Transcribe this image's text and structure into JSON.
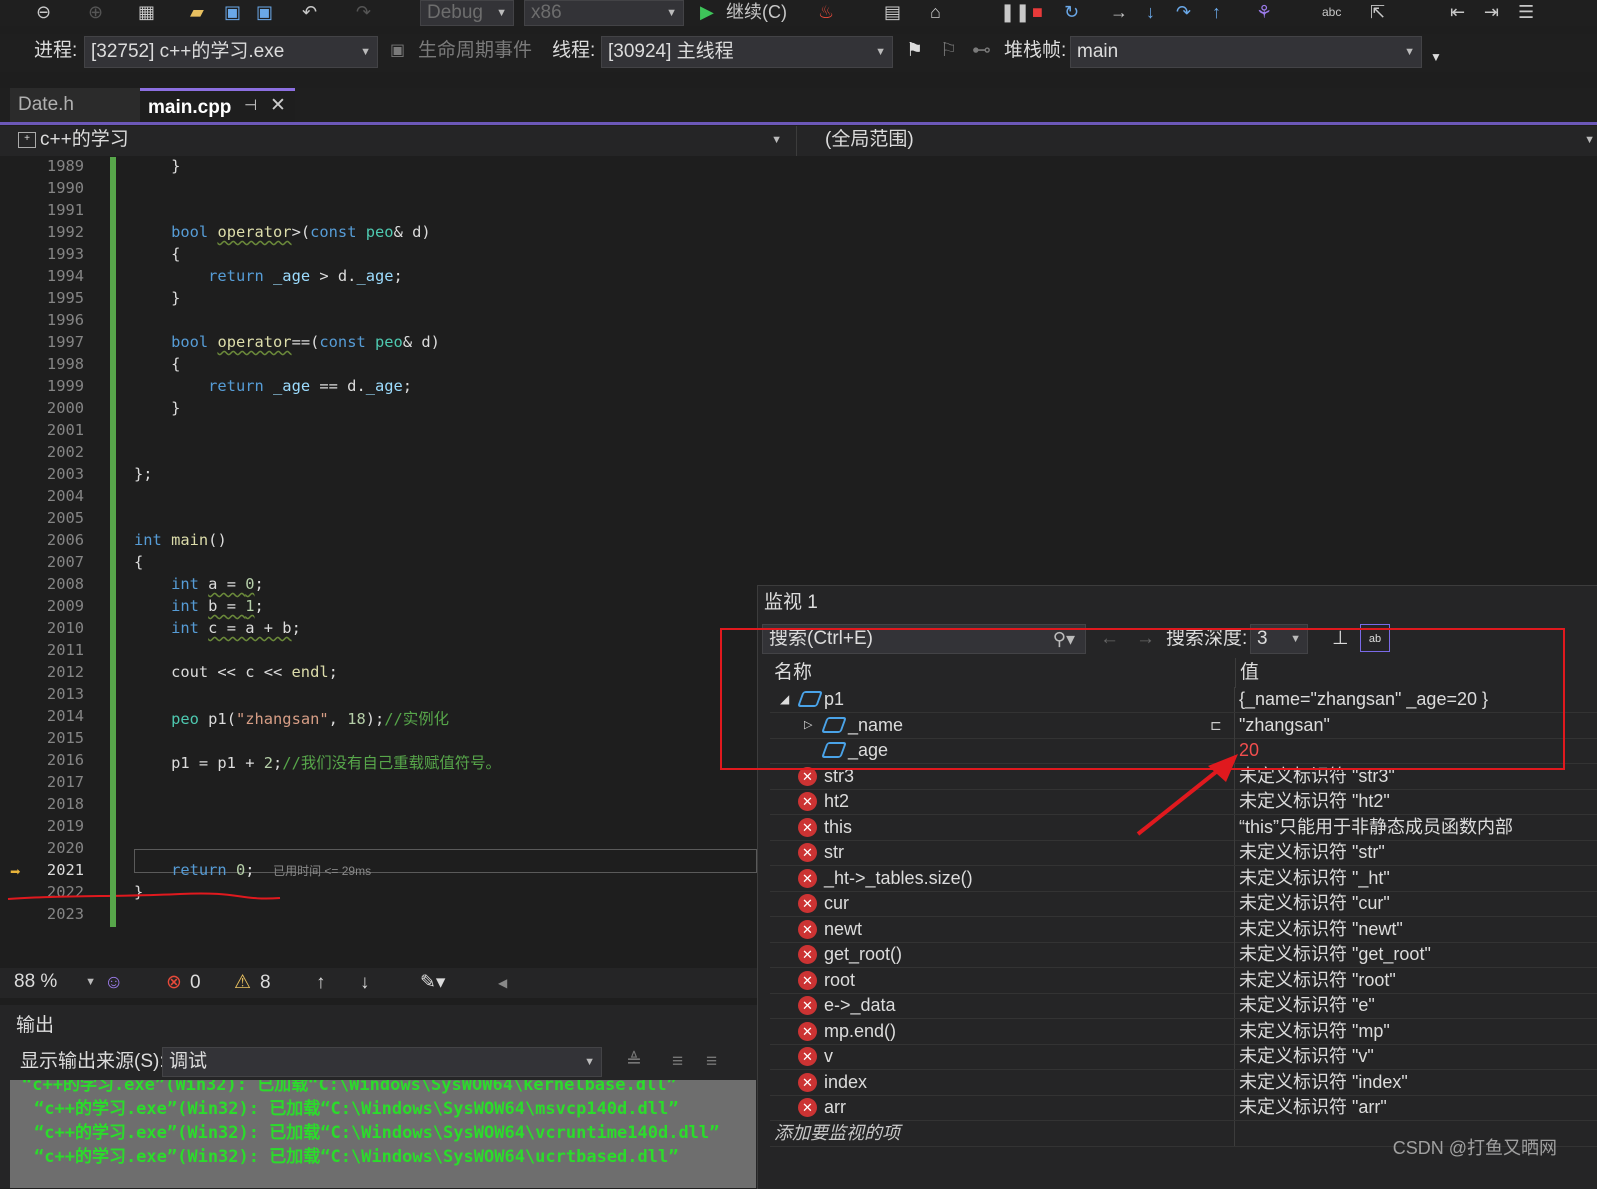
{
  "toolbar": {
    "config": "Debug",
    "platform": "x86",
    "continue_label": "继续(C)"
  },
  "debug_bar": {
    "process_label": "进程:",
    "process_value": "[32752] c++的学习.exe",
    "lifecycle_label": "生命周期事件",
    "thread_label": "线程:",
    "thread_value": "[30924] 主线程",
    "stackframe_label": "堆栈帧:",
    "stackframe_value": "main"
  },
  "tabs": [
    {
      "label": "Date.h"
    },
    {
      "label": "main.cpp"
    }
  ],
  "nav": {
    "project": "c++的学习",
    "scope": "(全局范围)"
  },
  "editor": {
    "line_numbers": [
      "1989",
      "1990",
      "1991",
      "1992",
      "1993",
      "1994",
      "1995",
      "1996",
      "1997",
      "1998",
      "1999",
      "2000",
      "2001",
      "2002",
      "2003",
      "2004",
      "2005",
      "2006",
      "2007",
      "2008",
      "2009",
      "2010",
      "2011",
      "2012",
      "2013",
      "2014",
      "2015",
      "2016",
      "2017",
      "2018",
      "2019",
      "2020",
      "2021",
      "2022",
      "2023"
    ],
    "elapsed_hint": "已用时间 <= 29ms",
    "comment_instantiate": "//实例化",
    "comment_assign": "//我们没有自己重载赋值符号。",
    "string_literal": "\"zhangsan\""
  },
  "status": {
    "zoom": "88 %",
    "errors": "0",
    "warnings": "8"
  },
  "output": {
    "title": "输出",
    "source_label": "显示输出来源(S):",
    "source_value": "调试",
    "lines": [
      "“c++的学习.exe”(Win32): 已加载“C:\\Windows\\SysWOW64\\kernelbase.dll”",
      "“c++的学习.exe”(Win32): 已加载“C:\\Windows\\SysWOW64\\msvcp140d.dll”",
      "“c++的学习.exe”(Win32): 已加载“C:\\Windows\\SysWOW64\\vcruntime140d.dll”",
      "“c++的学习.exe”(Win32): 已加载“C:\\Windows\\SysWOW64\\ucrtbased.dll”"
    ]
  },
  "watch": {
    "title": "监视 1",
    "search_placeholder": "搜索(Ctrl+E)",
    "depth_label": "搜索深度:",
    "depth_value": "3",
    "col_name": "名称",
    "col_value": "值",
    "rows": [
      {
        "name": "p1",
        "value": "{_name=\"zhangsan\" _age=20 }",
        "kind": "object",
        "level": 0
      },
      {
        "name": "_name",
        "value": "\"zhangsan\"",
        "kind": "object",
        "level": 1
      },
      {
        "name": "_age",
        "value": "20",
        "kind": "object",
        "level": 1
      },
      {
        "name": "str3",
        "value": "未定义标识符 \"str3\"",
        "kind": "error",
        "level": 0
      },
      {
        "name": "ht2",
        "value": "未定义标识符 \"ht2\"",
        "kind": "error",
        "level": 0
      },
      {
        "name": "this",
        "value": "“this”只能用于非静态成员函数内部",
        "kind": "error",
        "level": 0
      },
      {
        "name": "str",
        "value": "未定义标识符 \"str\"",
        "kind": "error",
        "level": 0
      },
      {
        "name": "_ht->_tables.size()",
        "value": "未定义标识符 \"_ht\"",
        "kind": "error",
        "level": 0
      },
      {
        "name": "cur",
        "value": "未定义标识符 \"cur\"",
        "kind": "error",
        "level": 0
      },
      {
        "name": "newt",
        "value": "未定义标识符 \"newt\"",
        "kind": "error",
        "level": 0
      },
      {
        "name": "get_root()",
        "value": "未定义标识符 \"get_root\"",
        "kind": "error",
        "level": 0
      },
      {
        "name": "root",
        "value": "未定义标识符 \"root\"",
        "kind": "error",
        "level": 0
      },
      {
        "name": "e->_data",
        "value": "未定义标识符 \"e\"",
        "kind": "error",
        "level": 0
      },
      {
        "name": "mp.end()",
        "value": "未定义标识符 \"mp\"",
        "kind": "error",
        "level": 0
      },
      {
        "name": "v",
        "value": "未定义标识符 \"v\"",
        "kind": "error",
        "level": 0
      },
      {
        "name": "index",
        "value": "未定义标识符 \"index\"",
        "kind": "error",
        "level": 0
      },
      {
        "name": "arr",
        "value": "未定义标识符 \"arr\"",
        "kind": "error",
        "level": 0
      }
    ],
    "add_item": "添加要监视的项"
  },
  "watermark": "CSDN @打鱼又晒网",
  "colors": {
    "accent": "#8c6fe0",
    "annotation_red": "#e0191e",
    "breakpoint_arrow": "#e8b33a",
    "changed_value": "#f24e4e"
  }
}
